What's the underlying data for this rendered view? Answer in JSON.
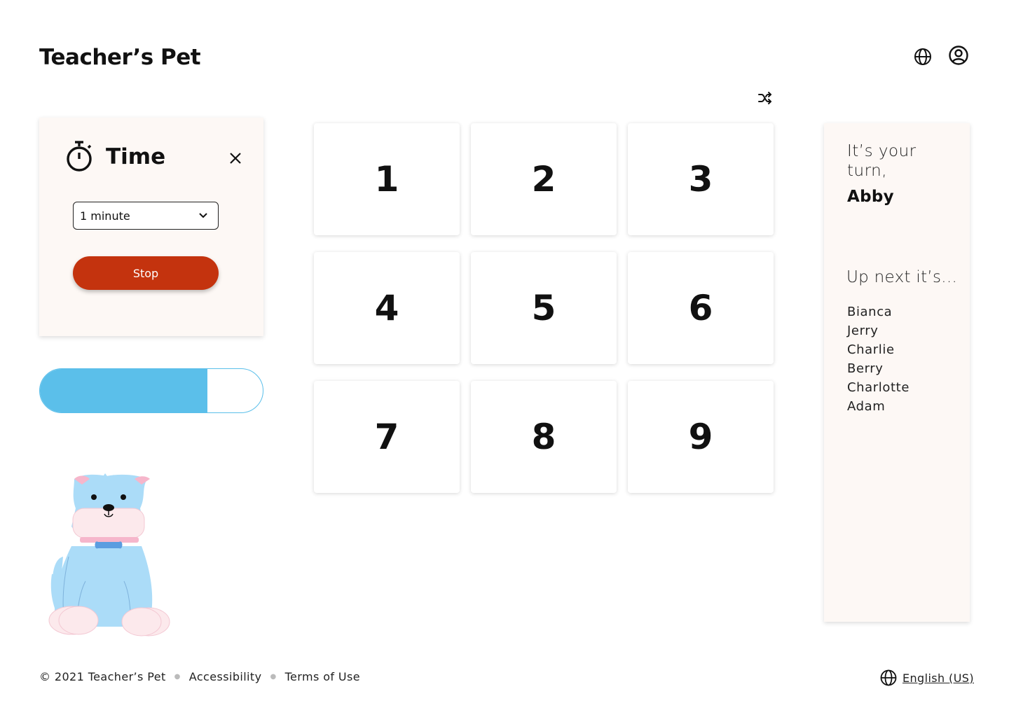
{
  "header": {
    "title": "Teacher’s Pet",
    "language_icon": "globe-icon",
    "account_icon": "user-circle-icon"
  },
  "shuffle_icon": "shuffle-icon",
  "timer": {
    "title": "Time",
    "icon": "stopwatch-icon",
    "close_icon": "close-icon",
    "duration": "1 minute",
    "dropdown_icon": "chevron-down-icon",
    "stop_label": "Stop",
    "stop_color": "#c4330e"
  },
  "progress": {
    "value": 0.75,
    "color": "#5bbfea"
  },
  "mascot": "dog-illustration",
  "tiles": [
    "1",
    "2",
    "3",
    "4",
    "5",
    "6",
    "7",
    "8",
    "9"
  ],
  "turn": {
    "label": "It’s your turn,",
    "name": "Abby",
    "next_label": "Up next it’s...",
    "next": [
      "Bianca",
      "Jerry",
      "Charlie",
      "Berry",
      "Charlotte",
      "Adam"
    ]
  },
  "footer": {
    "copyright": "© 2021 Teacher’s Pet",
    "accessibility": "Accessibility",
    "terms": "Terms of Use",
    "language": "English (US)"
  }
}
